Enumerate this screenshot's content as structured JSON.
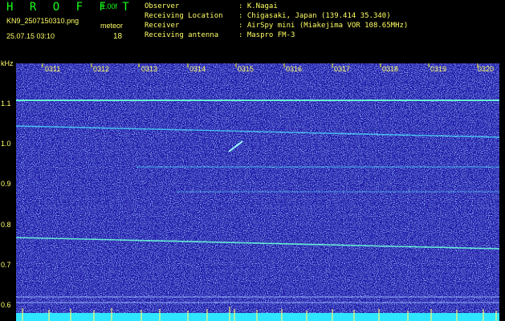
{
  "header": {
    "title": "H R O F F T",
    "version": "1.00f",
    "filename": "KN9_2507150310.png",
    "mode": "meteor",
    "datetime": "25.07.15 03:10",
    "count": "18"
  },
  "info": [
    {
      "label": "Observer",
      "value": ": K.Nagai"
    },
    {
      "label": "Receiving Location",
      "value": ": Chigasaki, Japan (139.414 35.340)"
    },
    {
      "label": "Receiver",
      "value": ": AirSpy mini (Miakejima VOR 108.65MHz)"
    },
    {
      "label": "Receiving antenna",
      "value": ": Maspro FM-3"
    }
  ],
  "axis": {
    "unit": "kHz",
    "y_ticks": [
      "1.1",
      "1.0",
      "0.9",
      "0.8",
      "0.7",
      "0.6"
    ],
    "time_ticks": [
      "0311",
      "0312",
      "0313",
      "0314",
      "0315",
      "0316",
      "0317",
      "0318",
      "0319",
      "0320"
    ]
  },
  "colors": {
    "background": "#000000",
    "spectrogram": "#1f1aa8",
    "title_green": "#19ff19",
    "label_yellow": "#ffff66",
    "trace_cyan": "#4be0ff",
    "tick_yellow": "#ffff00"
  }
}
